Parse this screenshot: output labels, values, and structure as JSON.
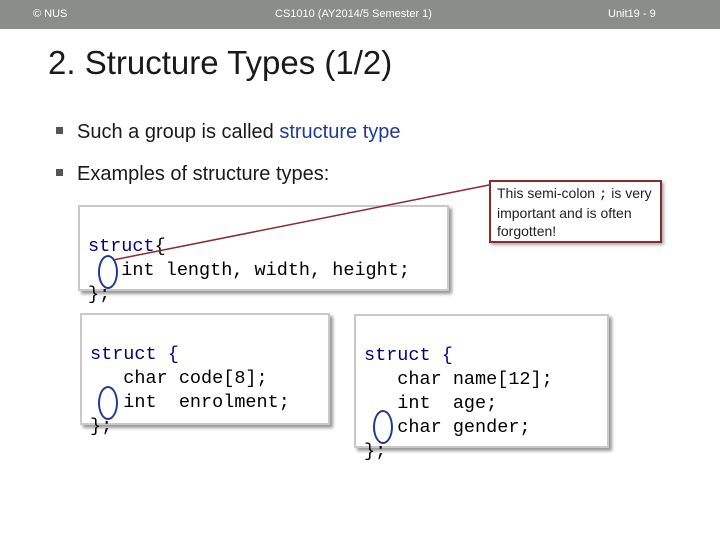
{
  "header": {
    "left": "© NUS",
    "center": "CS1010 (AY2014/5 Semester 1)",
    "right": "Unit19 - 9"
  },
  "slide": {
    "title": "2. Structure Types (1/2)",
    "bullet1_prefix": "Such a group is called ",
    "bullet1_emph": "structure type",
    "bullet2": "Examples of structure types:"
  },
  "callout": {
    "text_before": "This semi-colon ",
    "semicolon": ";",
    "text_after": " is very important and is often forgotten!"
  },
  "code_blocks": {
    "block1": {
      "line1_kw": "struct",
      "line1_rest": "{",
      "line2": "   int length, width, height;",
      "line3": "};"
    },
    "block2": {
      "line1_kw": "struct",
      "line1_rest": " {",
      "line2": "   char code[8];",
      "line3": "   int  enrolment;",
      "line4": "};"
    },
    "block3": {
      "line1_kw": "struct",
      "line1_rest": " {",
      "line2": "   char name[12];",
      "line3": "   int  age;",
      "line4": "   char gender;",
      "line5": "};"
    }
  }
}
